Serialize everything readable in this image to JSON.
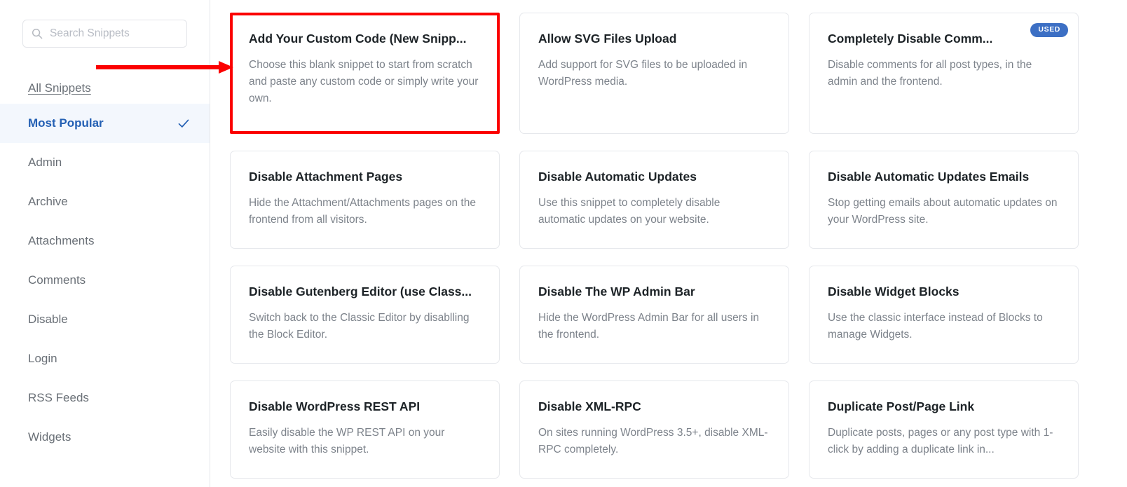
{
  "accent_colors": {
    "brand_blue": "#2460b4",
    "badge_blue": "#3c6fc4",
    "annotation_red": "#fb0000",
    "active_row_bg": "#f3f7fd",
    "title_text": "#1d2327",
    "body_text": "#7d838b"
  },
  "sidebar": {
    "search": {
      "placeholder": "Search Snippets",
      "value": "",
      "icon": "search-icon"
    },
    "items": [
      {
        "label": "All Snippets",
        "active": false,
        "underlined": true
      },
      {
        "label": "Most Popular",
        "active": true,
        "check_icon": "check-icon"
      },
      {
        "label": "Admin",
        "active": false
      },
      {
        "label": "Archive",
        "active": false
      },
      {
        "label": "Attachments",
        "active": false
      },
      {
        "label": "Comments",
        "active": false
      },
      {
        "label": "Disable",
        "active": false
      },
      {
        "label": "Login",
        "active": false
      },
      {
        "label": "RSS Feeds",
        "active": false
      },
      {
        "label": "Widgets",
        "active": false
      }
    ]
  },
  "annotation": {
    "type": "arrow",
    "direction": "right",
    "color": "#fb0000",
    "points_to": "Add Your Custom Code (New Snipp..."
  },
  "main": {
    "cards": [
      {
        "title": "Add Your Custom Code (New Snipp...",
        "description": "Choose this blank snippet to start from scratch and paste any custom code or simply write your own.",
        "highlighted": true,
        "badge": null
      },
      {
        "title": "Allow SVG Files Upload",
        "description": "Add support for SVG files to be uploaded in WordPress media.",
        "highlighted": false,
        "badge": null
      },
      {
        "title": "Completely Disable Comm...",
        "description": "Disable comments for all post types, in the admin and the frontend.",
        "highlighted": false,
        "badge": "USED"
      },
      {
        "title": "Disable Attachment Pages",
        "description": "Hide the Attachment/Attachments pages on the frontend from all visitors.",
        "highlighted": false,
        "badge": null
      },
      {
        "title": "Disable Automatic Updates",
        "description": "Use this snippet to completely disable automatic updates on your website.",
        "highlighted": false,
        "badge": null
      },
      {
        "title": "Disable Automatic Updates Emails",
        "description": "Stop getting emails about automatic updates on your WordPress site.",
        "highlighted": false,
        "badge": null
      },
      {
        "title": "Disable Gutenberg Editor (use Class...",
        "description": "Switch back to the Classic Editor by disablling the Block Editor.",
        "highlighted": false,
        "badge": null
      },
      {
        "title": "Disable The WP Admin Bar",
        "description": "Hide the WordPress Admin Bar for all users in the frontend.",
        "highlighted": false,
        "badge": null
      },
      {
        "title": "Disable Widget Blocks",
        "description": "Use the classic interface instead of Blocks to manage Widgets.",
        "highlighted": false,
        "badge": null
      },
      {
        "title": "Disable WordPress REST API",
        "description": "Easily disable the WP REST API on your website with this snippet.",
        "highlighted": false,
        "badge": null
      },
      {
        "title": "Disable XML-RPC",
        "description": "On sites running WordPress 3.5+, disable XML-RPC completely.",
        "highlighted": false,
        "badge": null
      },
      {
        "title": "Duplicate Post/Page Link",
        "description": "Duplicate posts, pages or any post type with 1-click by adding a duplicate link in...",
        "highlighted": false,
        "badge": null
      }
    ]
  }
}
